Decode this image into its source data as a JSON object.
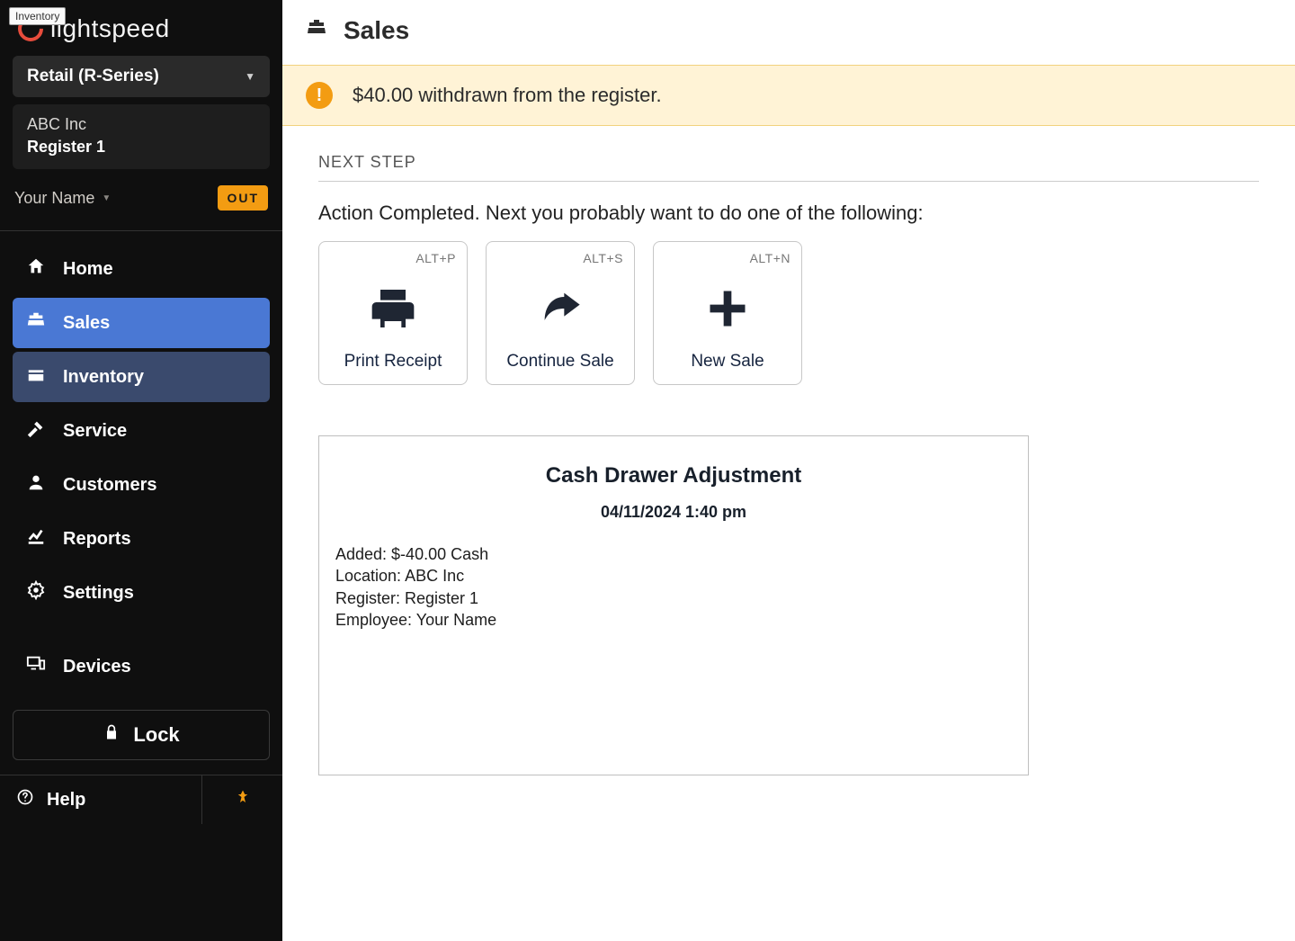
{
  "brand": {
    "name": "lightspeed"
  },
  "tooltip": "Inventory",
  "product_selector": {
    "label": "Retail (R-Series)"
  },
  "location": {
    "company": "ABC Inc",
    "register": "Register 1"
  },
  "user": {
    "name": "Your Name",
    "badge": "OUT"
  },
  "nav": {
    "home": "Home",
    "sales": "Sales",
    "inventory": "Inventory",
    "service": "Service",
    "customers": "Customers",
    "reports": "Reports",
    "settings": "Settings",
    "devices": "Devices",
    "lock": "Lock",
    "help": "Help"
  },
  "page": {
    "title": "Sales",
    "alert": "$40.00 withdrawn from the register.",
    "next_step_label": "NEXT STEP",
    "action_prompt": "Action Completed. Next you probably want to do one of the following:",
    "cards": {
      "print": {
        "label": "Print Receipt",
        "shortcut": "ALT+P"
      },
      "continue": {
        "label": "Continue Sale",
        "shortcut": "ALT+S"
      },
      "new": {
        "label": "New Sale",
        "shortcut": "ALT+N"
      }
    },
    "receipt": {
      "title": "Cash Drawer Adjustment",
      "datetime": "04/11/2024 1:40 pm",
      "lines": {
        "added": "Added: $-40.00 Cash",
        "location": "Location: ABC Inc",
        "register": "Register: Register 1",
        "employee": "Employee: Your Name"
      }
    }
  }
}
